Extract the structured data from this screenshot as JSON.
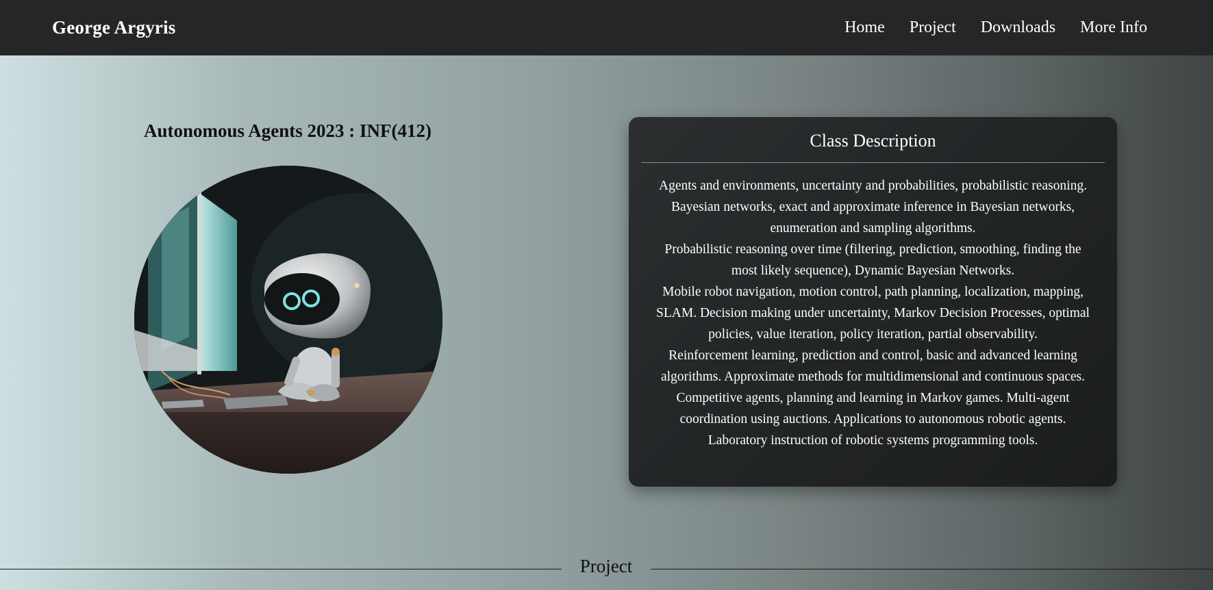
{
  "navbar": {
    "brand": "George Argyris",
    "links": [
      "Home",
      "Project",
      "Downloads",
      "More Info"
    ]
  },
  "course": {
    "title_prefix": "Autonomous Agents 2023 : ",
    "code": "INF(412)",
    "image_alt": "robot-at-computer-illustration"
  },
  "description": {
    "title": "Class Description",
    "lines": [
      "Agents and environments, uncertainty and probabilities, probabilistic reasoning.",
      "Bayesian networks, exact and approximate inference in Bayesian networks,",
      "enumeration and sampling algorithms.",
      "Probabilistic reasoning over time (filtering, prediction, smoothing, finding the",
      "most likely sequence), Dynamic Bayesian Networks.",
      "Mobile robot navigation, motion control, path planning, localization, mapping,",
      "SLAM. Decision making under uncertainty, Markov Decision Processes, optimal",
      "policies, value iteration, policy iteration, partial observability.",
      "Reinforcement learning, prediction and control, basic and advanced learning",
      "algorithms. Approximate methods for multidimensional and continuous spaces.",
      "Competitive agents, planning and learning in Markov games. Multi-agent",
      "coordination using auctions. Applications to autonomous robotic agents.",
      "Laboratory instruction of robotic systems programming tools."
    ]
  },
  "section": {
    "label": "Project"
  },
  "colors": {
    "navbar_bg": "#242627",
    "card_bg": "#222526",
    "accent_eye": "#7fe3e0"
  }
}
